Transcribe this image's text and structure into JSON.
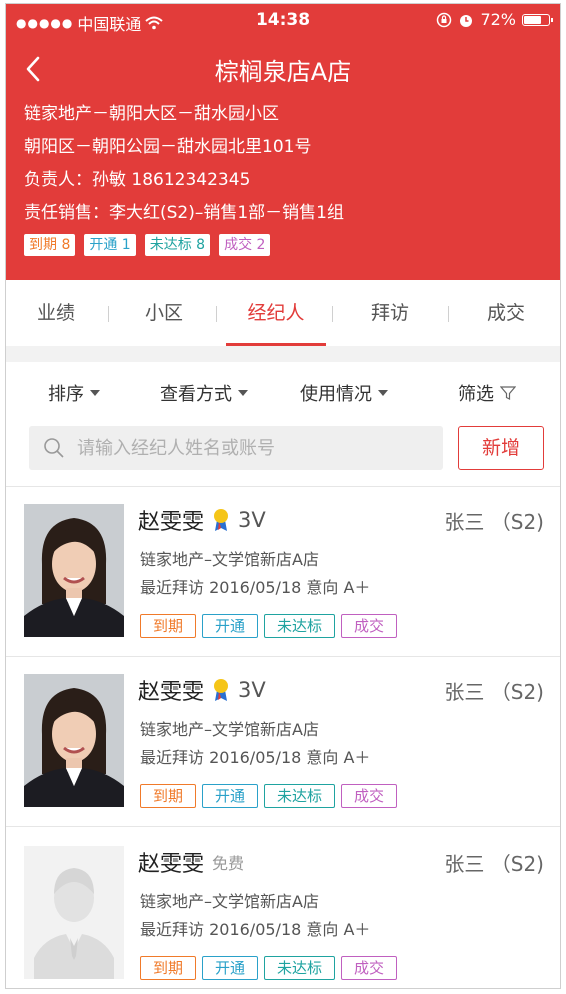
{
  "status_bar": {
    "carrier": "中国联通",
    "time": "14:38",
    "battery": "72%",
    "battery_level": 0.72,
    "signal_icon": "signal-dots-icon",
    "wifi_icon": "wifi-icon",
    "lock_icon": "rotation-lock-icon",
    "alarm_icon": "alarm-icon"
  },
  "header": {
    "title": "棕榈泉店A店",
    "back_icon": "chevron-left-icon",
    "lines": [
      "链家地产－朝阳大区－甜水园小区",
      "朝阳区－朝阳公园－甜水园北里101号",
      "负责人：孙敏   18612342345",
      "责任销售：李大红(S2)–销售1部－销售1组"
    ],
    "tags": [
      {
        "label": "到期 8",
        "color": "#f07a2a"
      },
      {
        "label": "开通 1",
        "color": "#2aa1c9"
      },
      {
        "label": "未达标 8",
        "color": "#1fa3a0"
      },
      {
        "label": "成交 2",
        "color": "#c060c0"
      }
    ]
  },
  "tabs": [
    {
      "label": "业绩"
    },
    {
      "label": "小区"
    },
    {
      "label": "经纪人",
      "active": true
    },
    {
      "label": "拜访"
    },
    {
      "label": "成交"
    }
  ],
  "filters": {
    "sort": "排序",
    "view": "查看方式",
    "usage": "使用情况",
    "filter": "筛选"
  },
  "search": {
    "placeholder": "请输入经纪人姓名或账号",
    "add_label": "新增"
  },
  "agents": [
    {
      "name": "赵雯雯",
      "badge_icon": "medal-icon",
      "level": "3V",
      "owner": "张三 （S2)",
      "office": "链家地产–文学馆新店A店",
      "visit": "最近拜访 2016/05/18   意向 A＋",
      "photo": "photo",
      "tags": [
        "到期",
        "开通",
        "未达标",
        "成交"
      ]
    },
    {
      "name": "赵雯雯",
      "badge_icon": "medal-icon",
      "level": "3V",
      "owner": "张三 （S2)",
      "office": "链家地产–文学馆新店A店",
      "visit": "最近拜访 2016/05/18   意向 A＋",
      "photo": "photo",
      "tags": [
        "到期",
        "开通",
        "未达标",
        "成交"
      ]
    },
    {
      "name": "赵雯雯",
      "free_label": "免费",
      "owner": "张三 （S2)",
      "office": "链家地产–文学馆新店A店",
      "visit": "最近拜访 2016/05/18   意向 A＋",
      "photo": "placeholder",
      "tags": [
        "到期",
        "开通",
        "未达标",
        "成交"
      ]
    }
  ],
  "colors": {
    "brand_red": "#e23c3a",
    "tag_orange": "#f07a2a",
    "tag_blue": "#2aa1c9",
    "tag_teal": "#1fa3a0",
    "tag_purple": "#c060c0"
  }
}
